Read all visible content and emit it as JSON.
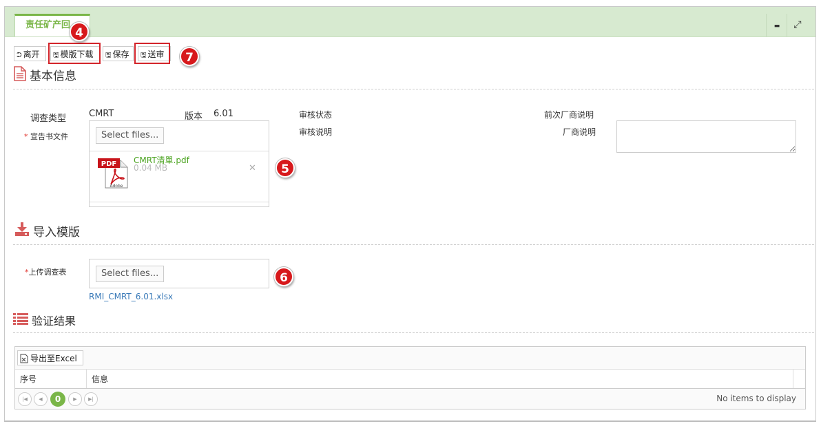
{
  "tab": {
    "label": "责任矿产回"
  },
  "window_buttons": {
    "minimize": "▬",
    "maximize": "⤢"
  },
  "toolbar": {
    "leave": "离开",
    "template_download": "模版下载",
    "save": "保存",
    "submit": "送审"
  },
  "badges": {
    "b4": "4",
    "b5": "5",
    "b6": "6",
    "b7": "7"
  },
  "basic_info": {
    "title": "基本信息",
    "survey_type_label": "调查类型",
    "survey_type_value": "CMRT",
    "version_label": "版本",
    "version_value": "6.01",
    "review_status_label": "审核状态",
    "review_note_label": "审核说明",
    "prev_vendor_note_label": "前次厂商说明",
    "vendor_note_label": "厂商说明",
    "declaration_required": "*",
    "declaration_label": "宣告书文件",
    "select_files": "Select files...",
    "file_name": "CMRT清單.pdf",
    "file_size": "0.04 MB",
    "remove": "✕",
    "pdf_tag": "PDF",
    "pdf_brand": "Adobe"
  },
  "import_template": {
    "title": "导入模版",
    "upload_required": "*",
    "upload_label": "上传调查表",
    "select_files": "Select files...",
    "template_link": "RMI_CMRT_6.01.xlsx"
  },
  "validation": {
    "title": "验证结果",
    "export_label": "导出至Excel",
    "columns": [
      "序号",
      "信息"
    ],
    "page_number": "0",
    "empty_text": "No items to display"
  }
}
